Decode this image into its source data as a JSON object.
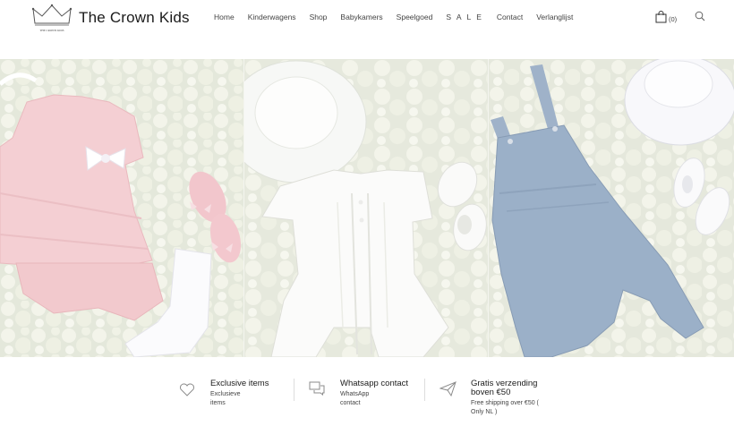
{
  "header": {
    "logo_text": "THE CROWN KIDS",
    "brand": "The Crown Kids",
    "nav": [
      "Home",
      "Kinderwagens",
      "Shop",
      "Babykamers",
      "Speelgoed",
      "S A L E",
      "Contact",
      "Verlanglijst"
    ],
    "cart_count": "(0)"
  },
  "hero": {
    "panels": [
      "pink-knit-outfit",
      "white-cable-romper",
      "blue-knit-dungarees"
    ]
  },
  "features": [
    {
      "icon": "heart-icon",
      "title": "Exclusive items",
      "subtitle": "Exclusieve items"
    },
    {
      "icon": "chat-icon",
      "title": "Whatsapp contact",
      "subtitle": "WhatsApp contact"
    },
    {
      "icon": "paper-plane-icon",
      "title": "Gratis verzending boven €50",
      "subtitle": "Free shipping over €50 ( Only NL )"
    }
  ]
}
